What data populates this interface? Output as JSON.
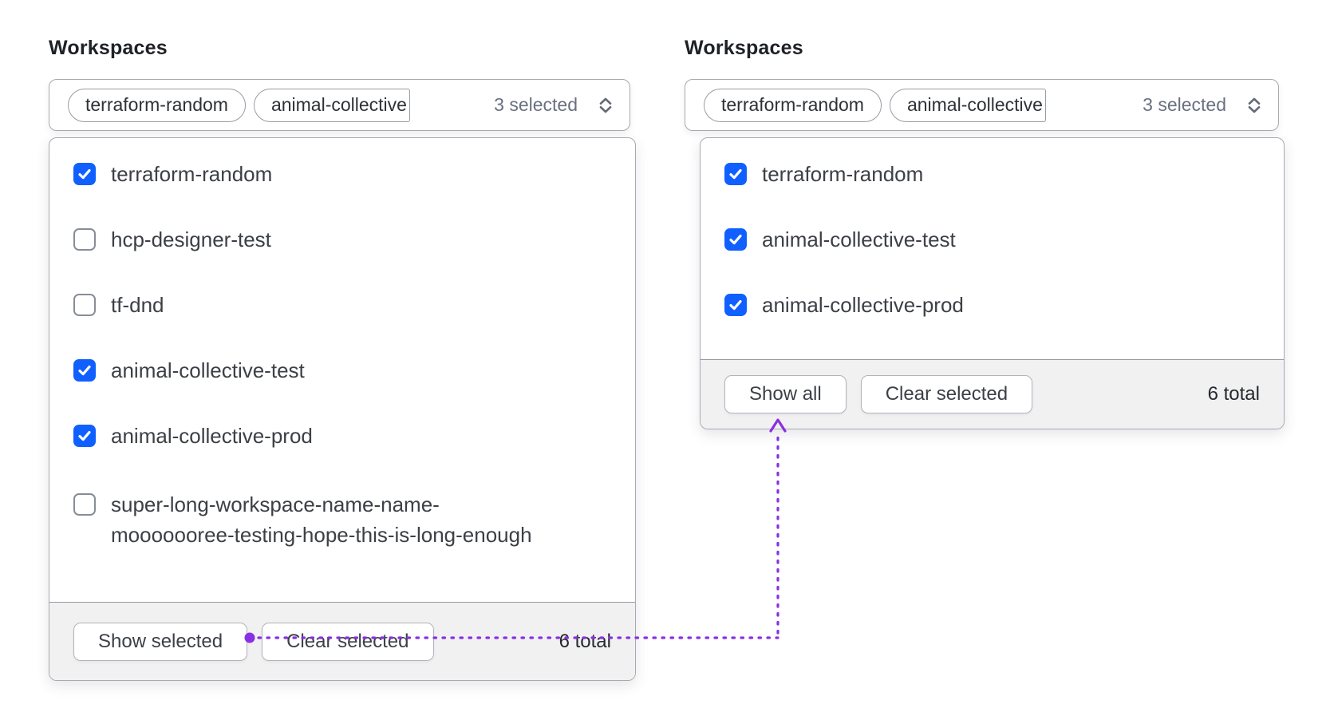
{
  "panels": {
    "left": {
      "label": "Workspaces",
      "trigger": {
        "tags": [
          {
            "label": "terraform-random"
          },
          {
            "label": "animal-collective"
          }
        ],
        "count_label": "3 selected"
      },
      "options": [
        {
          "label": "terraform-random",
          "checked": true
        },
        {
          "label": "hcp-designer-test",
          "checked": false
        },
        {
          "label": "tf-dnd",
          "checked": false
        },
        {
          "label": "animal-collective-test",
          "checked": true
        },
        {
          "label": "animal-collective-prod",
          "checked": true
        },
        {
          "label": "super-long-workspace-name-name-\nmooooooree-testing-hope-this-is-long-enough",
          "checked": false
        }
      ],
      "footer": {
        "show_button": "Show selected",
        "clear_button": "Clear selected",
        "total": "6 total"
      }
    },
    "right": {
      "label": "Workspaces",
      "trigger": {
        "tags": [
          {
            "label": "terraform-random"
          },
          {
            "label": "animal-collective"
          }
        ],
        "count_label": "3 selected"
      },
      "options": [
        {
          "label": "terraform-random",
          "checked": true
        },
        {
          "label": "animal-collective-test",
          "checked": true
        },
        {
          "label": "animal-collective-prod",
          "checked": true
        }
      ],
      "footer": {
        "show_button": "Show all",
        "clear_button": "Clear selected",
        "total": "6 total"
      }
    }
  },
  "colors": {
    "checkbox_blue": "#1060ff",
    "annotation_purple": "#8b2fe2",
    "border_gray": "#a7aab1",
    "footer_bg": "#f1f1f2"
  }
}
